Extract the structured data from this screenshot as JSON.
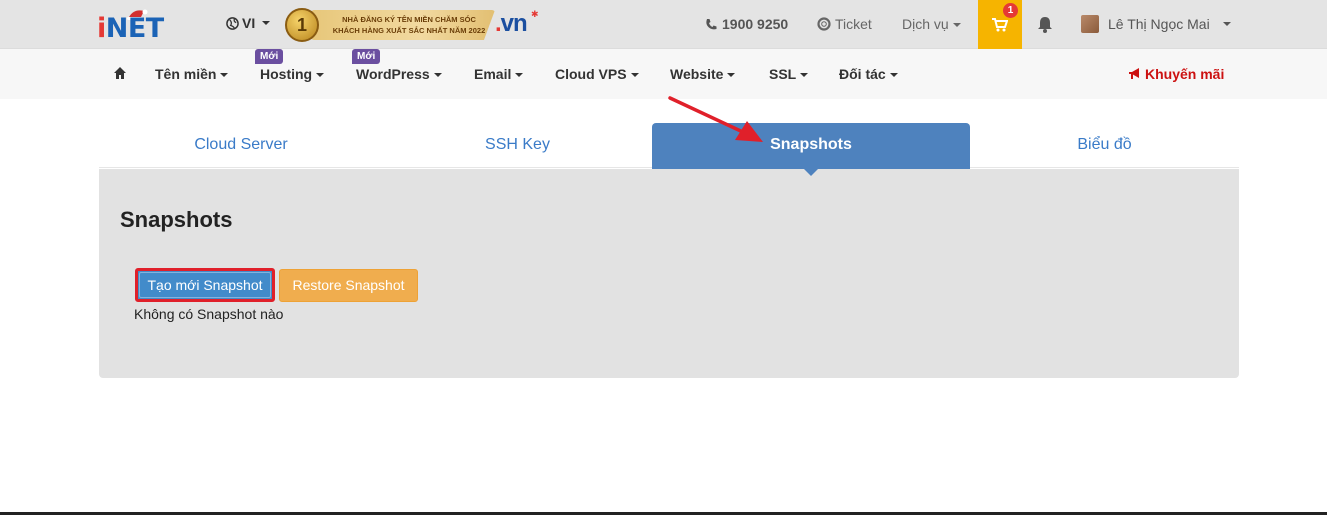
{
  "topbar": {
    "logo_text_i": "i",
    "logo_text_rest": "NET",
    "language": "VI",
    "banner": {
      "rank": "1",
      "line1": "NHÀ ĐĂNG KÝ TÊN MIỀN CHĂM SÓC",
      "line2": "KHÁCH HÀNG XUẤT SẮC NHẤT NĂM 2022",
      "vn": "vn"
    },
    "phone": "1900 9250",
    "ticket": "Ticket",
    "services": "Dịch vụ",
    "cart_count": "1",
    "user_name": "Lê Thị Ngọc Mai"
  },
  "nav": {
    "items": [
      {
        "label": "Tên miền"
      },
      {
        "label": "Hosting",
        "badge": "Mới"
      },
      {
        "label": "WordPress",
        "badge": "Mới"
      },
      {
        "label": "Email"
      },
      {
        "label": "Cloud VPS"
      },
      {
        "label": "Website"
      },
      {
        "label": "SSL"
      },
      {
        "label": "Đối tác"
      }
    ],
    "promo": "Khuyến mãi"
  },
  "tabs": [
    {
      "label": "Cloud Server",
      "active": false
    },
    {
      "label": "SSH Key",
      "active": false
    },
    {
      "label": "Snapshots",
      "active": true
    },
    {
      "label": "Biểu đồ",
      "active": false
    }
  ],
  "panel": {
    "title": "Snapshots",
    "create_button": "Tạo mới Snapshot",
    "restore_button": "Restore Snapshot",
    "empty_message": "Không có Snapshot nào"
  },
  "colors": {
    "accent": "#4e82be",
    "primary_button": "#428bca",
    "warning_button": "#f0ad4e",
    "cart": "#f6b400",
    "promo": "#cc1111",
    "annotation": "#e0202a"
  }
}
